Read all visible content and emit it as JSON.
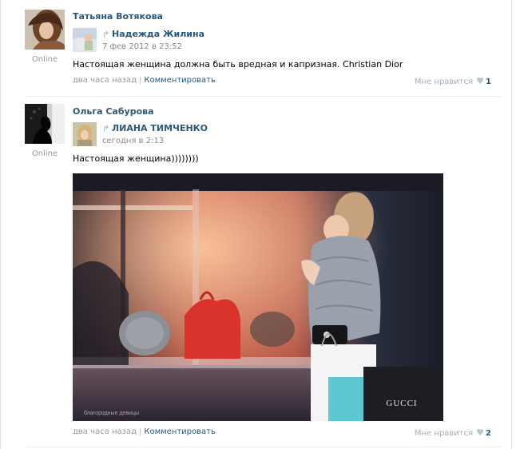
{
  "posts": [
    {
      "author": "Татьяна Вотякова",
      "online": "Online",
      "repost_name": "Надежда Жилина",
      "repost_date": "7 фев 2012 в 23:52",
      "text": "Настоящая женщина должна быть вредная и капризная. Christian Dior",
      "time": "два часа назад",
      "separator": "|",
      "comment_label": "Комментировать",
      "like_label": "Мне нравится",
      "like_count": "1"
    },
    {
      "author": "Ольга Сабурова",
      "online": "Online",
      "repost_name": "ЛИАНА ТИМЧЕНКО",
      "repost_date": "сегодня в 2:13",
      "text": "Настоящая женщина))))))))",
      "time": "два часа назад",
      "separator": "|",
      "comment_label": "Комментировать",
      "like_label": "Мне нравится",
      "like_count": "2"
    }
  ],
  "photo": {
    "watermark": "благородные девицы",
    "brand_text": "GUCCI"
  },
  "colors": {
    "link": "#2b587a",
    "muted": "#999999",
    "divider": "#e6ebf0"
  },
  "icons": [
    "repost-arrow-icon",
    "heart-icon"
  ]
}
